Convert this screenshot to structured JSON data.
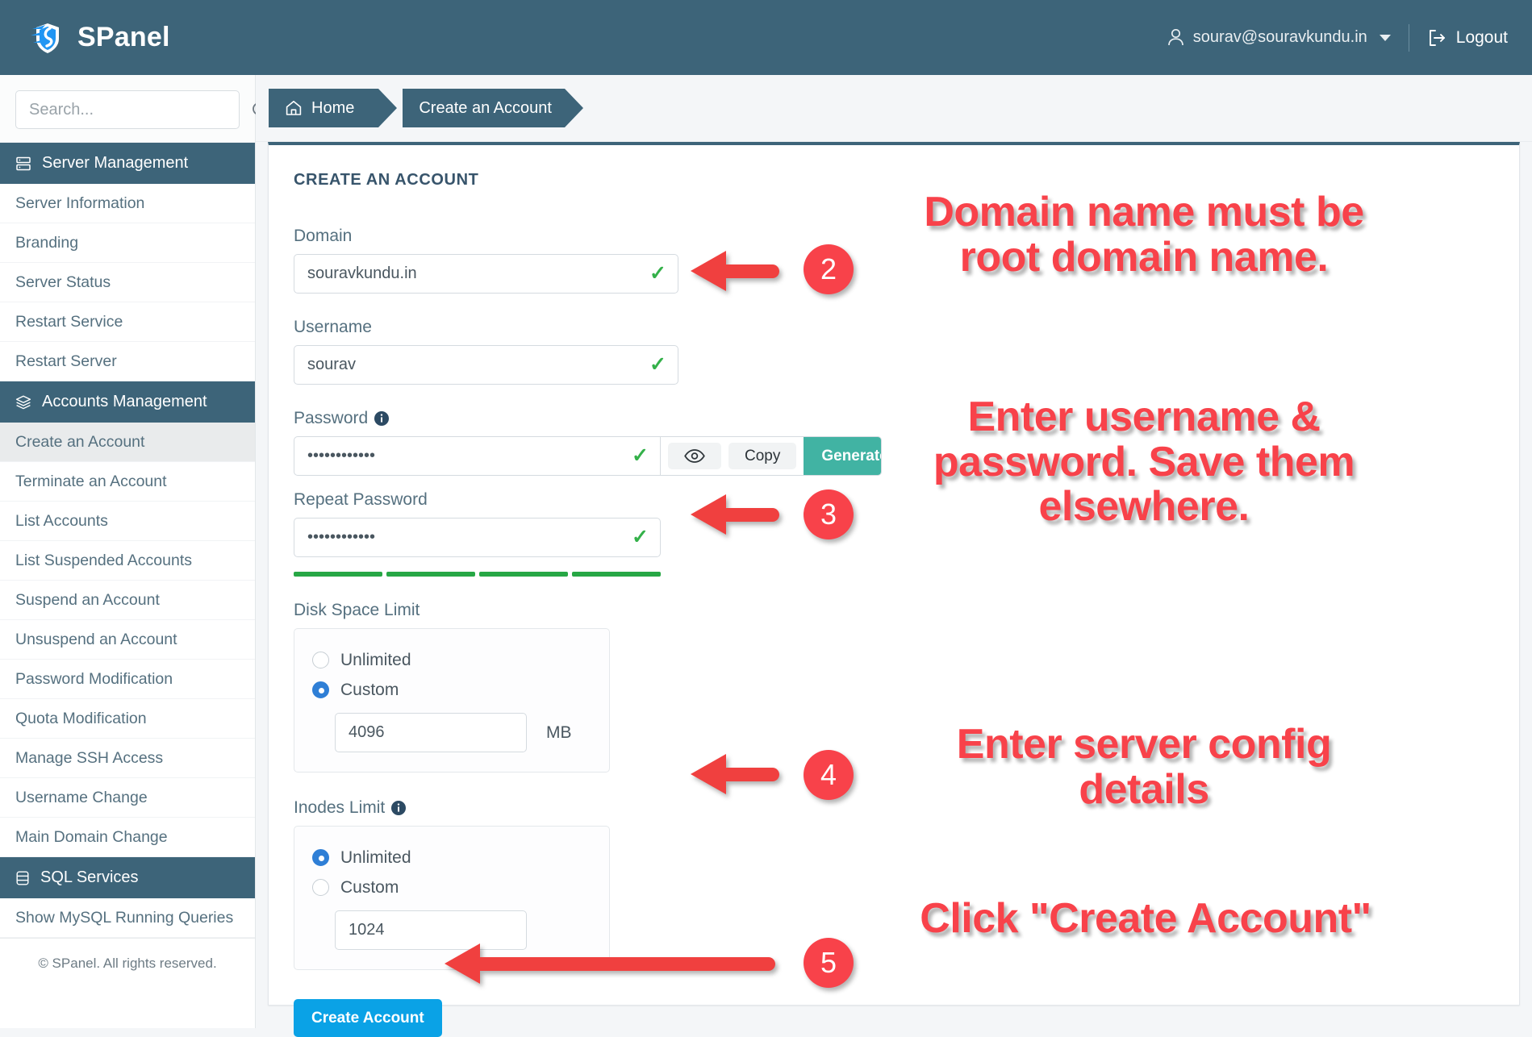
{
  "app": {
    "brand_title": "SPanel",
    "logo_icon": "spanel-shield-logo"
  },
  "header": {
    "user_email": "sourav@souravkundu.in",
    "user_icon": "user-icon",
    "logout_label": "Logout",
    "logout_icon": "logout-icon",
    "dropdown_icon": "chevron-down-icon"
  },
  "sidebar": {
    "search_placeholder": "Search...",
    "search_value": "",
    "search_icon": "search-icon",
    "groups": [
      {
        "title": "Server Management",
        "icon": "server-icon",
        "items": [
          {
            "label": "Server Information",
            "active": false
          },
          {
            "label": "Branding",
            "active": false
          },
          {
            "label": "Server Status",
            "active": false
          },
          {
            "label": "Restart Service",
            "active": false
          },
          {
            "label": "Restart Server",
            "active": false
          }
        ]
      },
      {
        "title": "Accounts Management",
        "icon": "layers-icon",
        "items": [
          {
            "label": "Create an Account",
            "active": true
          },
          {
            "label": "Terminate an Account",
            "active": false
          },
          {
            "label": "List Accounts",
            "active": false
          },
          {
            "label": "List Suspended Accounts",
            "active": false
          },
          {
            "label": "Suspend an Account",
            "active": false
          },
          {
            "label": "Unsuspend an Account",
            "active": false
          },
          {
            "label": "Password Modification",
            "active": false
          },
          {
            "label": "Quota Modification",
            "active": false
          },
          {
            "label": "Manage SSH Access",
            "active": false
          },
          {
            "label": "Username Change",
            "active": false
          },
          {
            "label": "Main Domain Change",
            "active": false
          }
        ]
      },
      {
        "title": "SQL Services",
        "icon": "database-icon",
        "items": [
          {
            "label": "Show MySQL Running Queries",
            "active": false
          }
        ]
      }
    ],
    "footer": "© SPanel. All rights reserved."
  },
  "breadcrumb": {
    "home_label": "Home",
    "home_icon": "home-icon",
    "current_label": "Create an Account"
  },
  "main": {
    "card_title": "CREATE AN ACCOUNT",
    "domain": {
      "label": "Domain",
      "value": "souravkundu.in",
      "valid_icon": "check-icon"
    },
    "username": {
      "label": "Username",
      "value": "sourav",
      "valid_icon": "check-icon"
    },
    "password": {
      "label": "Password",
      "info_icon": "info-icon",
      "value": "••••••••••••",
      "valid_icon": "check-icon",
      "show_icon": "eye-icon",
      "copy_label": "Copy",
      "generate_label": "Generate",
      "strength_segments": 4,
      "strength_color": "#27a745"
    },
    "repeat_password": {
      "label": "Repeat Password",
      "value": "••••••••••••",
      "valid_icon": "check-icon"
    },
    "disk_space": {
      "label": "Disk Space Limit",
      "option_unlimited": "Unlimited",
      "option_custom": "Custom",
      "selected": "Custom",
      "value": "4096",
      "unit": "MB"
    },
    "inodes": {
      "label": "Inodes Limit",
      "info_icon": "info-icon",
      "option_unlimited": "Unlimited",
      "option_custom": "Custom",
      "selected": "Unlimited",
      "value": "1024"
    },
    "submit_label": "Create Account"
  },
  "annotations": {
    "accent_color": "#f8424a",
    "items": [
      {
        "badge": "2",
        "text": "Domain name must be\nroot domain name."
      },
      {
        "badge": "3",
        "text": "Enter username &\npassword. Save them\nelsewhere."
      },
      {
        "badge": "4",
        "text": "Enter server config\ndetails"
      },
      {
        "badge": "5",
        "text": "Click \"Create Account\""
      }
    ]
  },
  "colors": {
    "header_bg": "#3d6479",
    "generate_btn": "#41b3a3",
    "primary_btn": "#0aa2e6",
    "valid_green": "#34b14a",
    "radio_blue": "#2f7fd6"
  }
}
